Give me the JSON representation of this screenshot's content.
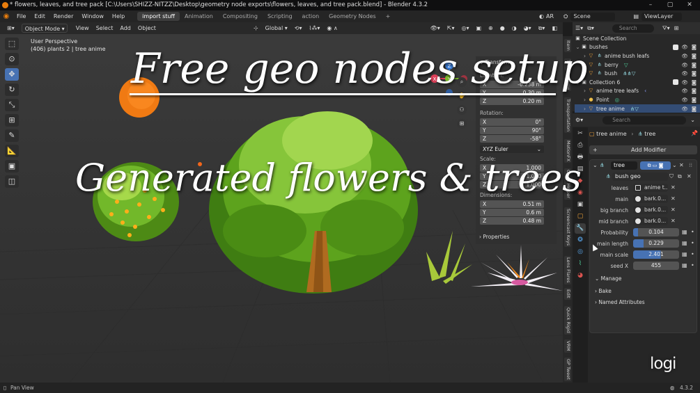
{
  "titlebar": {
    "title": "* flowers, leaves, and tree pack [C:\\Users\\SHIZZ-NITZZ\\Desktop\\geometry node exports\\flowers, leaves, and tree pack.blend] - Blender 4.3.2",
    "minimize": "–",
    "maximize": "▢",
    "close": "✕"
  },
  "menubar": {
    "menus": [
      "File",
      "Edit",
      "Render",
      "Window",
      "Help"
    ],
    "workspaces": [
      "import stuff",
      "Animation",
      "Compositing",
      "Scripting",
      "action",
      "Geometry Nodes"
    ],
    "active_workspace": "import stuff",
    "add_workspace": "+",
    "ar_label": "AR",
    "scene": "Scene",
    "view_layer": "ViewLayer"
  },
  "viewport": {
    "mode": "Object Mode",
    "menus": [
      "View",
      "Select",
      "Add",
      "Object"
    ],
    "transform_orientation": "Global",
    "search_placeholder": "Search",
    "view_name": "User Perspective",
    "object_info": "(406) plants 2 | tree anime",
    "gizmo_axes": {
      "x": "X",
      "y": "Y",
      "z": "Z"
    }
  },
  "n_panel": {
    "transform_header": "Transform",
    "location_label": "Location:",
    "location": [
      {
        "axis": "X",
        "value": "-6.238 m"
      },
      {
        "axis": "Y",
        "value": "0.30 m"
      },
      {
        "axis": "Z",
        "value": "0.20 m"
      }
    ],
    "rotation_label": "Rotation:",
    "rotation": [
      {
        "axis": "X",
        "value": "0°"
      },
      {
        "axis": "Y",
        "value": "90°"
      },
      {
        "axis": "Z",
        "value": "-58°"
      }
    ],
    "rotation_mode": "XYZ Euler",
    "scale_label": "Scale:",
    "scale": [
      {
        "axis": "X",
        "value": "1.000"
      },
      {
        "axis": "Y",
        "value": "1.000"
      },
      {
        "axis": "Z",
        "value": "1.000"
      }
    ],
    "dimensions_label": "Dimensions:",
    "dimensions": [
      {
        "axis": "X",
        "value": "0.51 m"
      },
      {
        "axis": "Y",
        "value": "0.6 m"
      },
      {
        "axis": "Z",
        "value": "0.48 m"
      }
    ],
    "properties_header": "Properties"
  },
  "sidebar_tabs": [
    "Item",
    "Tool",
    "View",
    "Transportation",
    "MotionFX",
    "Open Helper",
    "Screencast Keys",
    "Lens Flares",
    "Edit",
    "Quick Rigid",
    "VRM",
    "GP Tweet"
  ],
  "outliner": {
    "search_placeholder": "Search",
    "rows": [
      {
        "label": "Scene Collection",
        "level": 0,
        "icon": "collection"
      },
      {
        "label": "bushes",
        "level": 1,
        "icon": "collection"
      },
      {
        "label": "anime bush leafs",
        "level": 2,
        "icon": "object"
      },
      {
        "label": "berry",
        "level": 2,
        "icon": "object"
      },
      {
        "label": "bush",
        "level": 2,
        "icon": "object"
      },
      {
        "label": "Collection 6",
        "level": 1,
        "icon": "collection"
      },
      {
        "label": "anime tree leafs",
        "level": 2,
        "icon": "object"
      },
      {
        "label": "Point",
        "level": 2,
        "icon": "light"
      },
      {
        "label": "tree anime",
        "level": 2,
        "icon": "object"
      }
    ]
  },
  "properties": {
    "search_placeholder": "Search",
    "object_name": "tree anime",
    "modifier_target": "tree",
    "add_modifier": "Add Modifier",
    "modifier_name": "tree",
    "node_group": "bush geo",
    "inputs": [
      {
        "label": "leaves",
        "value": "anime t...",
        "kind": "object"
      },
      {
        "label": "main",
        "value": "bark.0...",
        "kind": "material"
      },
      {
        "label": "big branch",
        "value": "bark.0...",
        "kind": "material"
      },
      {
        "label": "mid branch",
        "value": "bark.0...",
        "kind": "material"
      }
    ],
    "numeric": [
      {
        "label": "Probability",
        "value": "0.104",
        "fraction": 0.104
      },
      {
        "label": "main  length",
        "value": "0.229",
        "fraction": 0.229
      },
      {
        "label": "main scale",
        "value": "2.401",
        "fraction": 0.6
      },
      {
        "label": "seed X",
        "value": "455",
        "fraction": 0
      }
    ],
    "subpanels": [
      "Manage",
      "Bake",
      "Named Attributes"
    ]
  },
  "overlay": {
    "headline": "Free geo nodes setup",
    "subline": "Generated flowers & trees",
    "watermark": "logi"
  },
  "statusbar": {
    "hint": "Pan View",
    "version": "4.3.2"
  },
  "colors": {
    "accent": "#4772b3",
    "brand_orange": "#e87d0d",
    "axis_x": "#e0405a",
    "axis_y": "#7fbf2a",
    "axis_z": "#3b7fdb"
  }
}
